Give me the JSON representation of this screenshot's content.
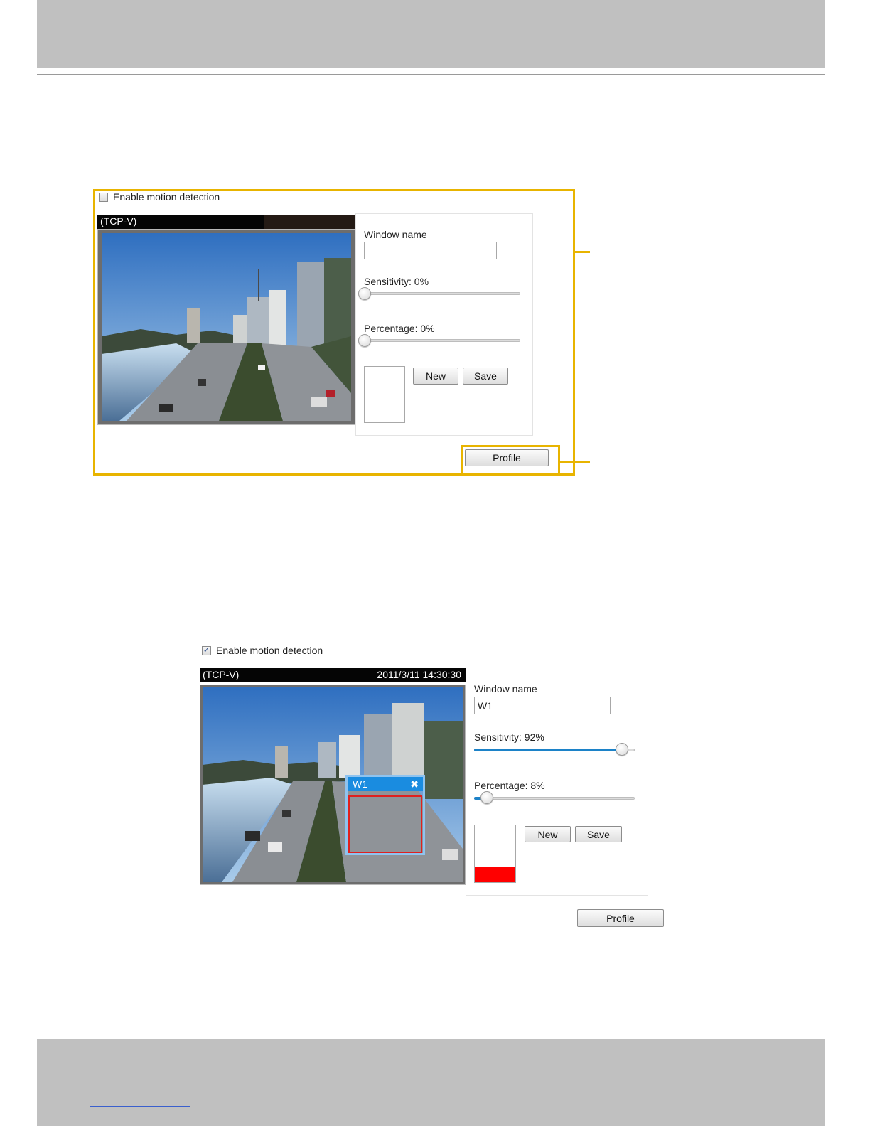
{
  "panel1": {
    "enable_label": "Enable motion detection",
    "enable_checked": false,
    "video_stream_label": "(TCP-V)",
    "video_timestamp": "",
    "scene_image_desc": "city-overpass-scene",
    "window_name_label": "Window name",
    "window_name_value": "",
    "sensitivity_label": "Sensitivity: 0%",
    "sensitivity_value": 0,
    "percentage_label": "Percentage: 0%",
    "percentage_value": 0,
    "activity_level": 0,
    "new_label": "New",
    "save_label": "Save",
    "profile_label": "Profile"
  },
  "panel2": {
    "enable_label": "Enable motion detection",
    "enable_checked": true,
    "checkbox_glyph": "✓",
    "video_stream_label": "(TCP-V)",
    "video_timestamp": "2011/3/11 14:30:30",
    "scene_image_desc": "city-overpass-scene",
    "motion_window_title": "W1",
    "motion_window_close": "✖",
    "window_name_label": "Window name",
    "window_name_value": "W1",
    "sensitivity_label": "Sensitivity: 92%",
    "sensitivity_value": 92,
    "percentage_label": "Percentage: 8%",
    "percentage_value": 8,
    "activity_level": 0.27,
    "new_label": "New",
    "save_label": "Save",
    "profile_label": "Profile"
  },
  "colors": {
    "highlight": "#e8b400",
    "slider_fill": "#1c82c8",
    "motion_window": "#1a8ce0",
    "motion_region": "#e0201e",
    "activity_bar": "#ff0000"
  }
}
